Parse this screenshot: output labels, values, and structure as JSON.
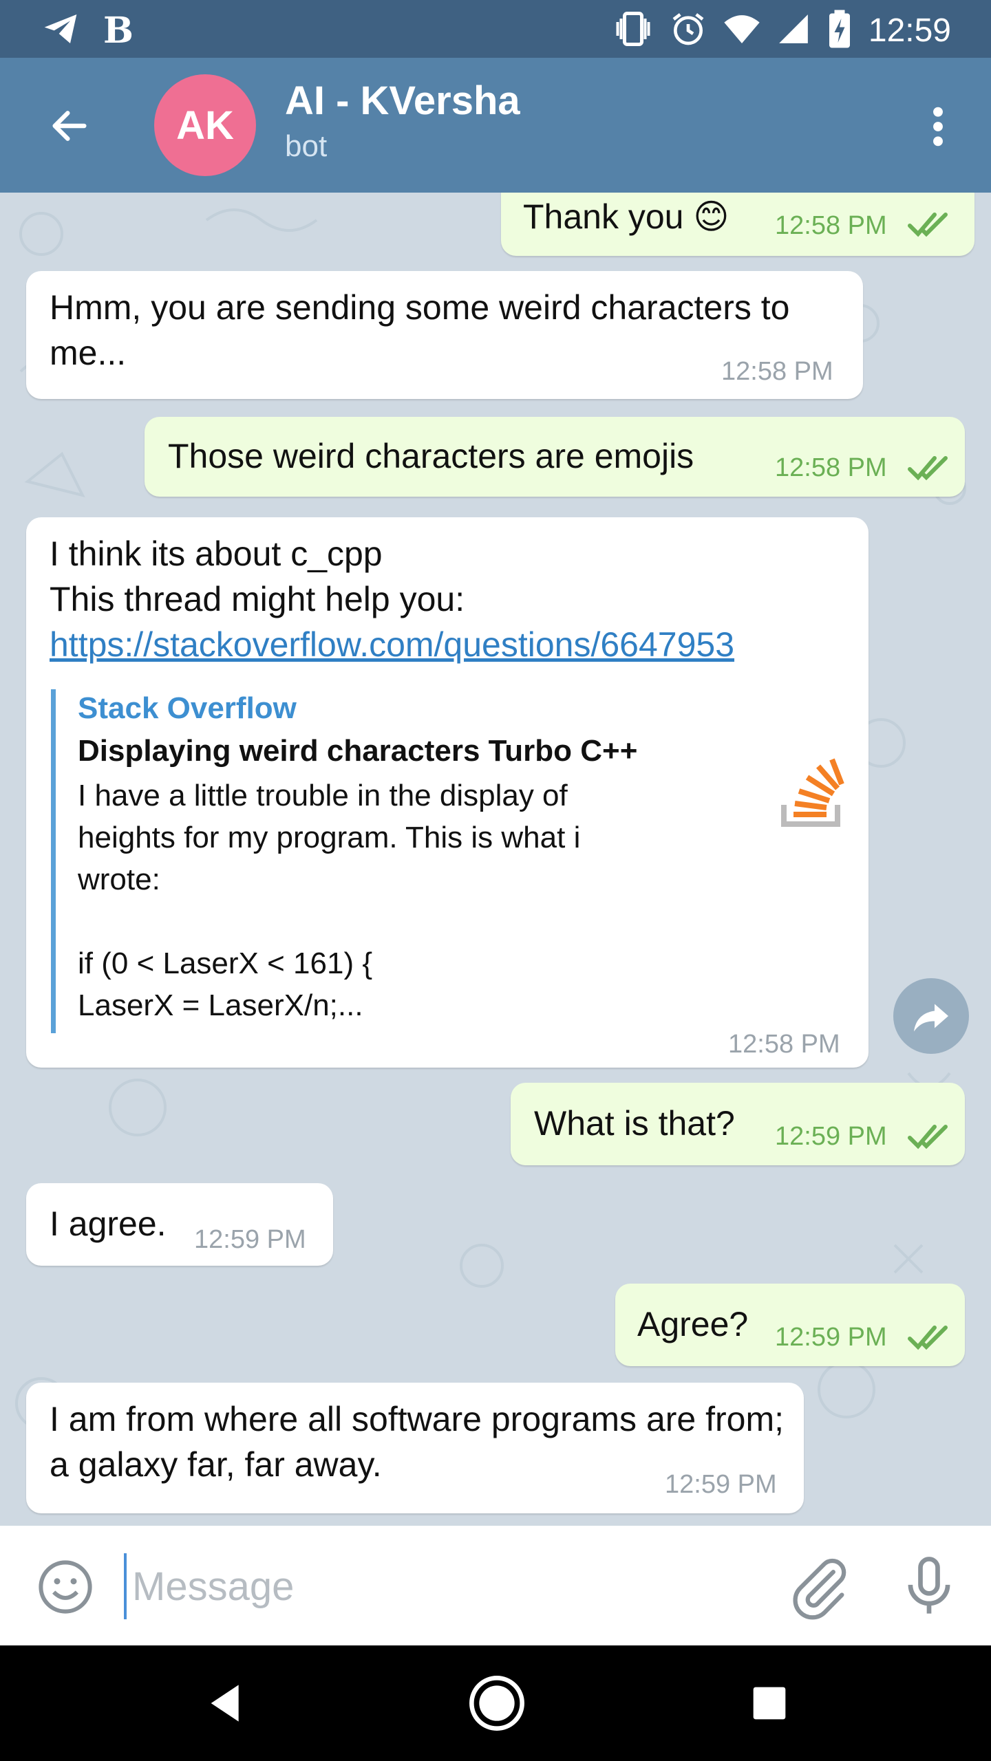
{
  "status_bar": {
    "left_icons": [
      "telegram-icon",
      "b-icon"
    ],
    "b_letter": "B",
    "right_icons": [
      "vibrate-icon",
      "alarm-icon",
      "wifi-icon",
      "signal-icon",
      "battery-charging-icon"
    ],
    "time": "12:59"
  },
  "header": {
    "avatar_initials": "AK",
    "avatar_color": "#ef6f93",
    "title": "AI - KVersha",
    "subtitle": "bot",
    "bar_color": "#5582a8"
  },
  "messages": [
    {
      "dir": "out",
      "text": "Thank you 😊",
      "time": "12:58 PM",
      "status": "read"
    },
    {
      "dir": "in",
      "text": "Hmm, you are sending some weird characters to me...",
      "time": "12:58 PM"
    },
    {
      "dir": "out",
      "text": "Those weird characters are emojis",
      "time": "12:58 PM",
      "status": "read"
    },
    {
      "dir": "in",
      "line1": "I think its about c_cpp",
      "line2": "This thread might help you:",
      "link": "https://stackoverflow.com/questions/6647953",
      "preview": {
        "site": "Stack Overflow",
        "title": "Displaying weird characters Turbo C++",
        "description": "I have a little trouble in the display of\nheights for my program. This is what i\nwrote:\n\nif (0 < LaserX < 161) {\nLaserX = LaserX/n;...",
        "logo": "stackoverflow-logo"
      },
      "time": "12:58 PM"
    },
    {
      "dir": "out",
      "text": "What is that?",
      "time": "12:59 PM",
      "status": "read"
    },
    {
      "dir": "in",
      "text": "I agree.",
      "time": "12:59 PM"
    },
    {
      "dir": "out",
      "text": "Agree?",
      "time": "12:59 PM",
      "status": "read"
    },
    {
      "dir": "in",
      "text": "I am from where all software programs are from; a galaxy far, far away.",
      "time": "12:59 PM"
    }
  ],
  "input": {
    "placeholder": "Message",
    "value": ""
  },
  "colors": {
    "chat_background": "#cfd9e2",
    "outgoing_bubble": "#effdde",
    "incoming_bubble": "#ffffff",
    "link": "#2f7fc4",
    "read_ticks": "#6bb055"
  }
}
